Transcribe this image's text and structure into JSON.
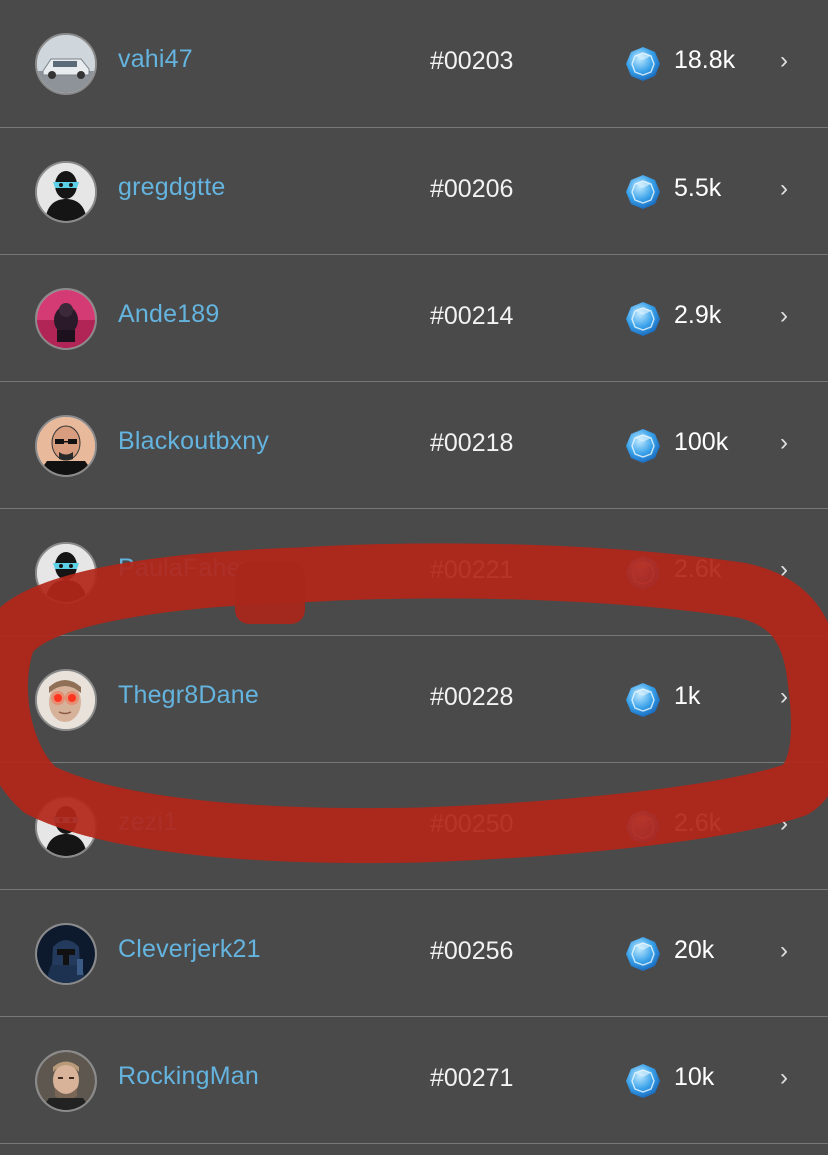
{
  "leaderboard": {
    "rows": [
      {
        "username": "vahi47",
        "rank": "#00203",
        "score": "18.8k",
        "avatar": "car-avatar",
        "chevron": "›"
      },
      {
        "username": "gregdgtte",
        "rank": "#00206",
        "score": "5.5k",
        "avatar": "masked-silhouette-avatar",
        "chevron": "›"
      },
      {
        "username": "Ande189",
        "rank": "#00214",
        "score": "2.9k",
        "avatar": "pink-photo-avatar",
        "chevron": "›"
      },
      {
        "username": "Blackoutbxny",
        "rank": "#00218",
        "score": "100k",
        "avatar": "bald-man-avatar",
        "chevron": "›"
      },
      {
        "username": "PaulaFahey",
        "rank": "#00221",
        "score": "2.6k",
        "avatar": "masked-silhouette-avatar",
        "chevron": "›"
      },
      {
        "username": "Thegr8Dane",
        "rank": "#00228",
        "score": "1k",
        "avatar": "red-eyes-face-avatar",
        "chevron": "›"
      },
      {
        "username": "zezi1",
        "rank": "#00250",
        "score": "2.6k",
        "avatar": "masked-silhouette-avatar",
        "chevron": "›"
      },
      {
        "username": "Cleverjerk21",
        "rank": "#00256",
        "score": "20k",
        "avatar": "armored-character-avatar",
        "chevron": "›"
      },
      {
        "username": "RockingMan",
        "rank": "#00271",
        "score": "10k",
        "avatar": "man-photo-avatar",
        "chevron": "›"
      }
    ]
  },
  "colors": {
    "background": "#4a4a4a",
    "username": "#64b4df",
    "highlight_marker": "#b3261a"
  },
  "icons": {
    "currency": "blue-gem-icon"
  }
}
